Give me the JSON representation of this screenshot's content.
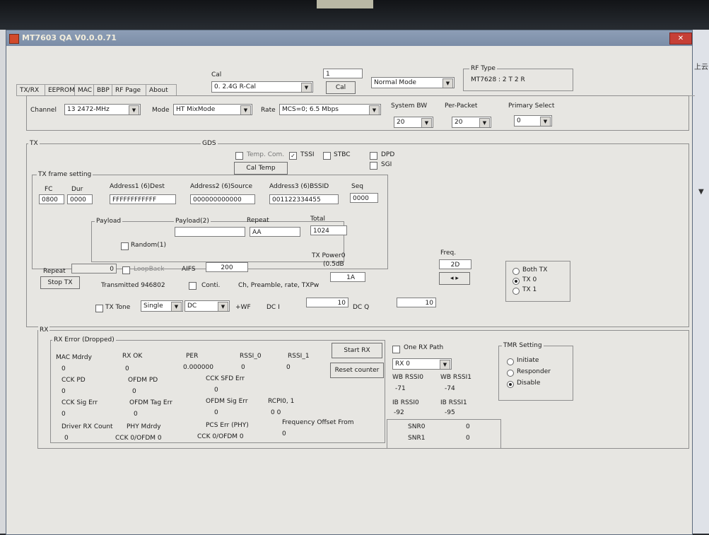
{
  "window": {
    "title": "MT7603 QA V0.0.0.71"
  },
  "right_strip": {
    "label": "上云"
  },
  "tabs": [
    "TX/RX",
    "EEPROM",
    "MAC",
    "BBP",
    "RF Page",
    "About"
  ],
  "cal": {
    "label": "Cal",
    "select_value": "0. 2.4G R-Cal",
    "input_value": "1",
    "button": "Cal",
    "mode": "Normal Mode"
  },
  "rf_type": {
    "label": "RF Type",
    "value": "MT7628 : 2 T 2 R"
  },
  "channel": {
    "label": "Channel",
    "value": "13 2472-MHz",
    "mode_label": "Mode",
    "mode_value": "HT MixMode",
    "rate_label": "Rate",
    "rate_value": "MCS=0;  6.5 Mbps"
  },
  "system_bw": {
    "label": "System BW",
    "value": "20"
  },
  "per_packet": {
    "label": "Per-Packet",
    "value": "20"
  },
  "primary_select": {
    "label": "Primary Select",
    "value": "0"
  },
  "tx": {
    "label": "TX",
    "gds": "GDS",
    "temp_com": "Temp. Com.",
    "tssi": "TSSI",
    "stbc": "STBC",
    "dpd": "DPD",
    "sgi": "SGI",
    "cal_temp": "Cal Temp"
  },
  "frame": {
    "label": "TX frame setting",
    "fc_label": "FC",
    "fc": "0800",
    "dur_label": "Dur",
    "dur": "0000",
    "addr1_label": "Address1 (6)Dest",
    "addr1": "FFFFFFFFFFFF",
    "addr2_label": "Address2 (6)Source",
    "addr2": "000000000000",
    "addr3_label": "Address3 (6)BSSID",
    "addr3": "001122334455",
    "seq_label": "Seq",
    "seq": "0000",
    "payload_label": "Payload",
    "payload2_label": "Payload(2)",
    "repeat_label": "Repeat",
    "repeat": "AA",
    "total_label": "Total",
    "total": "1024",
    "random_label": "Random(1)"
  },
  "tx_ctrl": {
    "repeat_label": "Repeat",
    "repeat": "0",
    "loopback": "LoopBack",
    "aifs_label": "AIFS",
    "aifs": "200",
    "stop_tx": "Stop TX",
    "transmitted": "Transmitted 946802",
    "conti": "Conti.",
    "ch_pre": "Ch, Preamble, rate, TXPw",
    "tx_power_label": "TX Power0",
    "tx_power_db": "(0.5dB",
    "tx_power_value": "1A",
    "freq_label": "Freq.",
    "freq_value": "2D",
    "tx_tone": "TX Tone",
    "tone_mode": "Single",
    "tone_dc": "DC",
    "wf": "+WF",
    "dci_label": "DC I",
    "dci": "10",
    "dcq_label": "DC Q",
    "dcq": "10",
    "both_tx": "Both TX",
    "tx0": "TX 0",
    "tx1": "TX 1"
  },
  "rx": {
    "label": "RX",
    "error_label": "RX Error (Dropped)",
    "mac_mdrdy": "MAC Mdrdy",
    "mac_mdrdy_v": "0",
    "rx_ok": "RX OK",
    "rx_ok_v": "0",
    "per": "PER",
    "per_v": "0.000000",
    "rssi0": "RSSI_0",
    "rssi0_v": "0",
    "rssi1": "RSSI_1",
    "rssi1_v": "0",
    "cck_pd": "CCK PD",
    "cck_pd_v": "0",
    "ofdm_pd": "OFDM PD",
    "ofdm_pd_v": "0",
    "cck_sfd": "CCK SFD Err",
    "cck_sfd_v": "0",
    "cck_sig": "CCK Sig Err",
    "cck_sig_v": "0",
    "ofdm_tag": "OFDM Tag Err",
    "ofdm_tag_v": "0",
    "ofdm_sig": "OFDM Sig Err",
    "ofdm_sig_v": "0",
    "rcpi": "RCPI0, 1",
    "rcpi_v": "0  0",
    "driver_rx": "Driver RX Count",
    "driver_rx_v": "0",
    "phy_mdrdy": "PHY Mdrdy",
    "phy_mdrdy_v": "CCK 0/OFDM 0",
    "pcs_err": "PCS Err (PHY)",
    "pcs_err_v": "CCK 0/OFDM 0",
    "freq_offset": "Frequency Offset From",
    "freq_offset_v": "0",
    "start_rx": "Start RX",
    "reset_counter": "Reset counter",
    "one_rx_path": "One RX Path",
    "rx_select": "RX 0",
    "wb_rssi0": "WB RSSI0",
    "wb_rssi0_v": "-71",
    "wb_rssi1": "WB RSSI1",
    "wb_rssi1_v": "-74",
    "ib_rssi0": "IB RSSI0",
    "ib_rssi0_v": "-92",
    "ib_rssi1": "IB RSSI1",
    "ib_rssi1_v": "-95",
    "snr0": "SNR0",
    "snr0_v": "0",
    "snr1": "SNR1",
    "snr1_v": "0",
    "tmr_setting": "TMR Setting",
    "initiate": "Initiate",
    "responder": "Responder",
    "disable": "Disable"
  }
}
